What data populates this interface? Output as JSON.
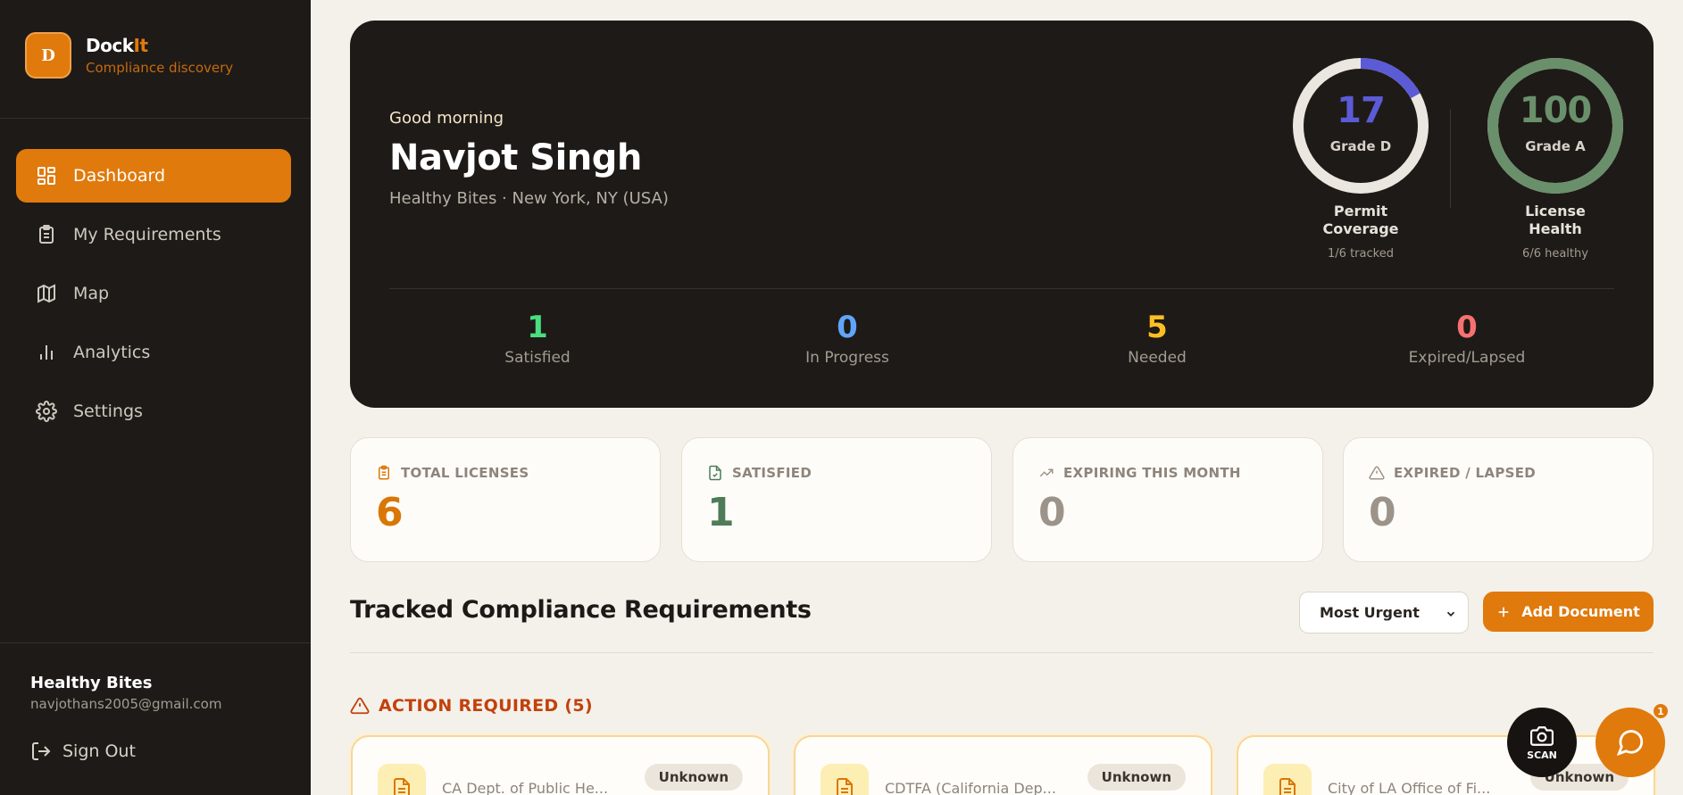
{
  "brand": {
    "logo_letter": "D",
    "name_main": "Dock",
    "name_accent": "It",
    "subtitle": "Compliance discovery"
  },
  "nav": [
    {
      "label": "Dashboard",
      "icon": "dashboard-icon",
      "active": true
    },
    {
      "label": "My Requirements",
      "icon": "clipboard-icon",
      "active": false
    },
    {
      "label": "Map",
      "icon": "map-icon",
      "active": false
    },
    {
      "label": "Analytics",
      "icon": "bar-chart-icon",
      "active": false
    },
    {
      "label": "Settings",
      "icon": "gear-icon",
      "active": false
    }
  ],
  "account": {
    "name": "Healthy Bites",
    "email": "navjothans2005@gmail.com",
    "sign_out": "Sign Out"
  },
  "hero": {
    "greeting": "Good morning",
    "user_name": "Navjot Singh",
    "location": "Healthy Bites · New York, NY (USA)",
    "rings": [
      {
        "value": "17",
        "grade": "Grade D",
        "label_line1": "Permit",
        "label_line2": "Coverage",
        "sub": "1/6 tracked",
        "percent": 17,
        "color": "#5b5bd6"
      },
      {
        "value": "100",
        "grade": "Grade A",
        "label_line1": "License",
        "label_line2": "Health",
        "sub": "6/6 healthy",
        "percent": 100,
        "color": "#6a8f6b"
      }
    ],
    "stats": [
      {
        "value": "1",
        "label": "Satisfied",
        "color": "#4ade80"
      },
      {
        "value": "0",
        "label": "In Progress",
        "color": "#60a5fa"
      },
      {
        "value": "5",
        "label": "Needed",
        "color": "#fbbf24"
      },
      {
        "value": "0",
        "label": "Expired/Lapsed",
        "color": "#f87171"
      }
    ]
  },
  "cards": [
    {
      "title": "TOTAL LICENSES",
      "value": "6",
      "icon": "clipboard-icon",
      "color": "#d97706"
    },
    {
      "title": "SATISFIED",
      "value": "1",
      "icon": "file-check-icon",
      "color": "#4d7c57"
    },
    {
      "title": "EXPIRING THIS MONTH",
      "value": "0",
      "icon": "trending-up-icon",
      "color": "#9c948a"
    },
    {
      "title": "EXPIRED / LAPSED",
      "value": "0",
      "icon": "warning-icon",
      "color": "#9c948a"
    }
  ],
  "section": {
    "title": "Tracked Compliance Requirements",
    "sort_value": "Most Urgent",
    "add_label": "Add Document",
    "action_header": "ACTION REQUIRED (5)"
  },
  "requirements": [
    {
      "agency": "CA Dept. of Public He...",
      "status": "Unknown"
    },
    {
      "agency": "CDTFA (California Dep...",
      "status": "Unknown"
    },
    {
      "agency": "City of LA Office of Fi...",
      "status": "Unknown"
    }
  ],
  "fab": {
    "scan_label": "SCAN",
    "chat_badge": "1"
  }
}
